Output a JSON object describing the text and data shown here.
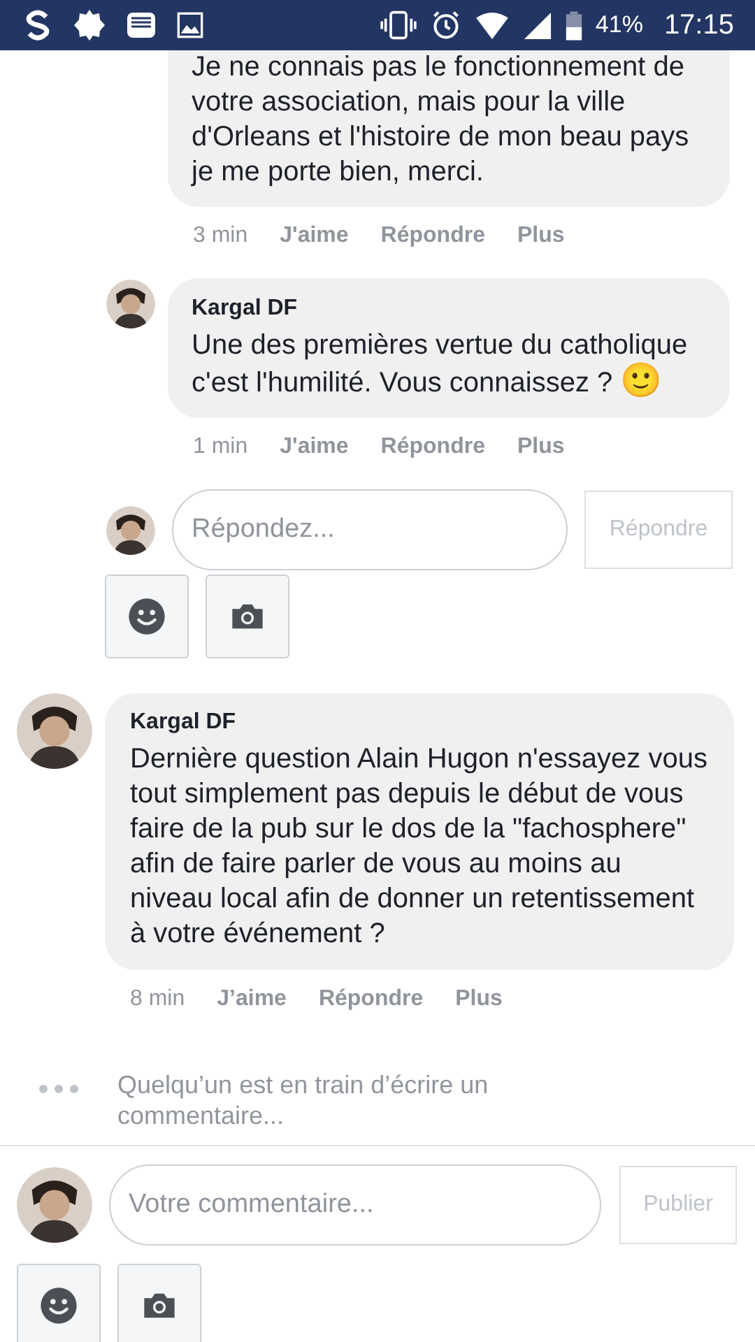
{
  "status_bar": {
    "battery": "41%",
    "time": "17:15"
  },
  "replies": [
    {
      "text": "Je ne connais pas le fonctionnement de votre association, mais pour la ville d'Orleans et l'histoire de mon beau pays je me porte bien, merci.",
      "actions": [
        "3 min",
        "J'aime",
        "Répondre",
        "Plus"
      ]
    },
    {
      "author": "Kargal DF",
      "text": "Une des premières vertue du catholique c'est l'humilité. Vous connaissez ?",
      "emoji": "🙂",
      "actions": [
        "1 min",
        "J'aime",
        "Répondre",
        "Plus"
      ]
    }
  ],
  "reply_composer": {
    "placeholder": "Répondez...",
    "button": "Répondre",
    "button_disabled": true
  },
  "comment": {
    "author": "Kargal DF",
    "text": "Dernière question Alain Hugon n'essayez vous tout simplement pas depuis le début de vous faire de la pub sur le dos de la \"fachosphere\" afin de faire parler de vous au moins au niveau local afin de donner un retentissement à votre événement ?",
    "actions": [
      "8 min",
      "J’aime",
      "Répondre",
      "Plus"
    ]
  },
  "typing_indicator": "Quelqu’un est en train d’écrire un commentaire...",
  "comment_composer": {
    "placeholder": "Votre commentaire...",
    "button": "Publier",
    "button_disabled": true
  }
}
